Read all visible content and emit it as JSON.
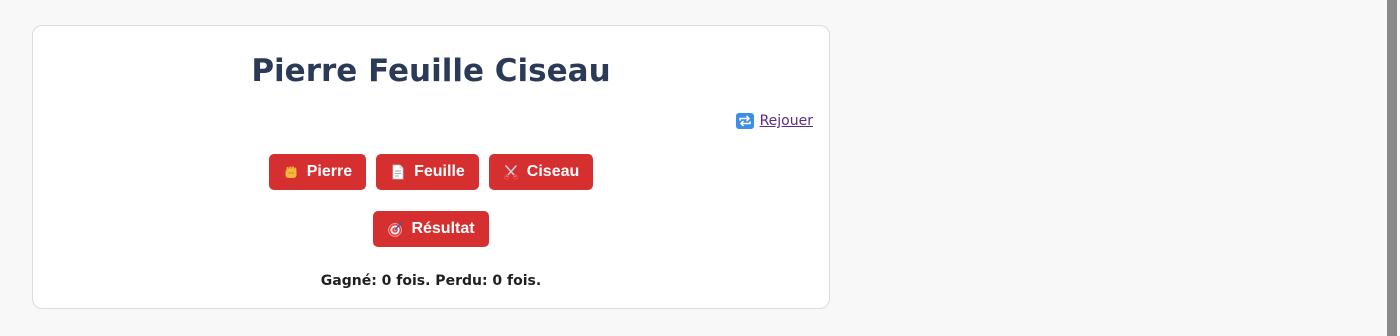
{
  "game": {
    "title": "Pierre Feuille Ciseau",
    "replay_label": "Rejouer",
    "choices": [
      {
        "label": "Pierre",
        "icon": "fist-icon"
      },
      {
        "label": "Feuille",
        "icon": "page-icon"
      },
      {
        "label": "Ciseau",
        "icon": "scissors-icon"
      }
    ],
    "result_label": "Résultat",
    "result_icon": "target-icon",
    "score_text": "Gagné: 0 fois. Perdu: 0 fois."
  },
  "colors": {
    "button": "#d62f30",
    "title": "#2b3a57",
    "link": "#5b2b8c",
    "background": "#f8f8f8"
  }
}
